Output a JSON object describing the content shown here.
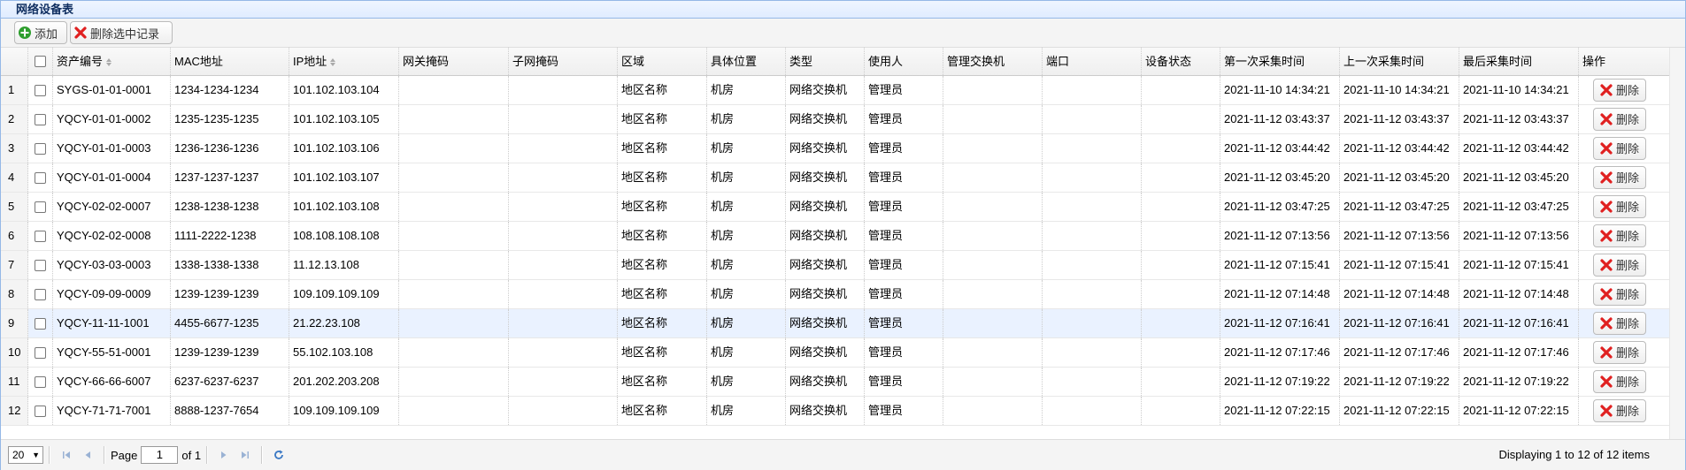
{
  "panel": {
    "title": "网络设备表"
  },
  "toolbar": {
    "add_label": "添加",
    "delete_selected_label": "删除选中记录"
  },
  "columns": [
    "资产编号",
    "MAC地址",
    "IP地址",
    "网关掩码",
    "子网掩码",
    "区域",
    "具体位置",
    "类型",
    "使用人",
    "管理交换机",
    "端口",
    "设备状态",
    "第一次采集时间",
    "上一次采集时间",
    "最后采集时间",
    "操作"
  ],
  "rows": [
    {
      "n": "1",
      "asset": "SYGS-01-01-0001",
      "mac": "1234-1234-1234",
      "ip": "101.102.103.104",
      "gw": "",
      "subnet": "",
      "area": "地区名称",
      "loc": "机房",
      "type": "网络交换机",
      "user": "管理员",
      "switch": "",
      "port": "",
      "status": "",
      "first": "2021-11-10 14:34:21",
      "prev": "2021-11-10 14:34:21",
      "last": "2021-11-10 14:34:21",
      "del": "删除"
    },
    {
      "n": "2",
      "asset": "YQCY-01-01-0002",
      "mac": "1235-1235-1235",
      "ip": "101.102.103.105",
      "gw": "",
      "subnet": "",
      "area": "地区名称",
      "loc": "机房",
      "type": "网络交换机",
      "user": "管理员",
      "switch": "",
      "port": "",
      "status": "",
      "first": "2021-11-12 03:43:37",
      "prev": "2021-11-12 03:43:37",
      "last": "2021-11-12 03:43:37",
      "del": "删除"
    },
    {
      "n": "3",
      "asset": "YQCY-01-01-0003",
      "mac": "1236-1236-1236",
      "ip": "101.102.103.106",
      "gw": "",
      "subnet": "",
      "area": "地区名称",
      "loc": "机房",
      "type": "网络交换机",
      "user": "管理员",
      "switch": "",
      "port": "",
      "status": "",
      "first": "2021-11-12 03:44:42",
      "prev": "2021-11-12 03:44:42",
      "last": "2021-11-12 03:44:42",
      "del": "删除"
    },
    {
      "n": "4",
      "asset": "YQCY-01-01-0004",
      "mac": "1237-1237-1237",
      "ip": "101.102.103.107",
      "gw": "",
      "subnet": "",
      "area": "地区名称",
      "loc": "机房",
      "type": "网络交换机",
      "user": "管理员",
      "switch": "",
      "port": "",
      "status": "",
      "first": "2021-11-12 03:45:20",
      "prev": "2021-11-12 03:45:20",
      "last": "2021-11-12 03:45:20",
      "del": "删除"
    },
    {
      "n": "5",
      "asset": "YQCY-02-02-0007",
      "mac": "1238-1238-1238",
      "ip": "101.102.103.108",
      "gw": "",
      "subnet": "",
      "area": "地区名称",
      "loc": "机房",
      "type": "网络交换机",
      "user": "管理员",
      "switch": "",
      "port": "",
      "status": "",
      "first": "2021-11-12 03:47:25",
      "prev": "2021-11-12 03:47:25",
      "last": "2021-11-12 03:47:25",
      "del": "删除"
    },
    {
      "n": "6",
      "asset": "YQCY-02-02-0008",
      "mac": "1111-2222-1238",
      "ip": "108.108.108.108",
      "gw": "",
      "subnet": "",
      "area": "地区名称",
      "loc": "机房",
      "type": "网络交换机",
      "user": "管理员",
      "switch": "",
      "port": "",
      "status": "",
      "first": "2021-11-12 07:13:56",
      "prev": "2021-11-12 07:13:56",
      "last": "2021-11-12 07:13:56",
      "del": "删除"
    },
    {
      "n": "7",
      "asset": "YQCY-03-03-0003",
      "mac": "1338-1338-1338",
      "ip": "11.12.13.108",
      "gw": "",
      "subnet": "",
      "area": "地区名称",
      "loc": "机房",
      "type": "网络交换机",
      "user": "管理员",
      "switch": "",
      "port": "",
      "status": "",
      "first": "2021-11-12 07:15:41",
      "prev": "2021-11-12 07:15:41",
      "last": "2021-11-12 07:15:41",
      "del": "删除"
    },
    {
      "n": "8",
      "asset": "YQCY-09-09-0009",
      "mac": "1239-1239-1239",
      "ip": "109.109.109.109",
      "gw": "",
      "subnet": "",
      "area": "地区名称",
      "loc": "机房",
      "type": "网络交换机",
      "user": "管理员",
      "switch": "",
      "port": "",
      "status": "",
      "first": "2021-11-12 07:14:48",
      "prev": "2021-11-12 07:14:48",
      "last": "2021-11-12 07:14:48",
      "del": "删除"
    },
    {
      "n": "9",
      "asset": "YQCY-11-11-1001",
      "mac": "4455-6677-1235",
      "ip": "21.22.23.108",
      "gw": "",
      "subnet": "",
      "area": "地区名称",
      "loc": "机房",
      "type": "网络交换机",
      "user": "管理员",
      "switch": "",
      "port": "",
      "status": "",
      "first": "2021-11-12 07:16:41",
      "prev": "2021-11-12 07:16:41",
      "last": "2021-11-12 07:16:41",
      "del": "删除",
      "selected": true
    },
    {
      "n": "10",
      "asset": "YQCY-55-51-0001",
      "mac": "1239-1239-1239",
      "ip": "55.102.103.108",
      "gw": "",
      "subnet": "",
      "area": "地区名称",
      "loc": "机房",
      "type": "网络交换机",
      "user": "管理员",
      "switch": "",
      "port": "",
      "status": "",
      "first": "2021-11-12 07:17:46",
      "prev": "2021-11-12 07:17:46",
      "last": "2021-11-12 07:17:46",
      "del": "删除"
    },
    {
      "n": "11",
      "asset": "YQCY-66-66-6007",
      "mac": "6237-6237-6237",
      "ip": "201.202.203.208",
      "gw": "",
      "subnet": "",
      "area": "地区名称",
      "loc": "机房",
      "type": "网络交换机",
      "user": "管理员",
      "switch": "",
      "port": "",
      "status": "",
      "first": "2021-11-12 07:19:22",
      "prev": "2021-11-12 07:19:22",
      "last": "2021-11-12 07:19:22",
      "del": "删除"
    },
    {
      "n": "12",
      "asset": "YQCY-71-71-7001",
      "mac": "8888-1237-7654",
      "ip": "109.109.109.109",
      "gw": "",
      "subnet": "",
      "area": "地区名称",
      "loc": "机房",
      "type": "网络交换机",
      "user": "管理员",
      "switch": "",
      "port": "",
      "status": "",
      "first": "2021-11-12 07:22:15",
      "prev": "2021-11-12 07:22:15",
      "last": "2021-11-12 07:22:15",
      "del": "删除"
    }
  ],
  "pager": {
    "page_size": "20",
    "page_label": "Page",
    "page_value": "1",
    "of_label": "of 1",
    "info": "Displaying 1 to 12 of 12 items"
  },
  "icons": {
    "add": "plus-circle-icon",
    "delete": "red-x-icon",
    "refresh": "refresh-icon"
  },
  "colors": {
    "accent": "#95b8e7",
    "selected_row": "#eaf2ff",
    "add_icon": "#2e9e2e",
    "delete_icon": "#e02020"
  }
}
